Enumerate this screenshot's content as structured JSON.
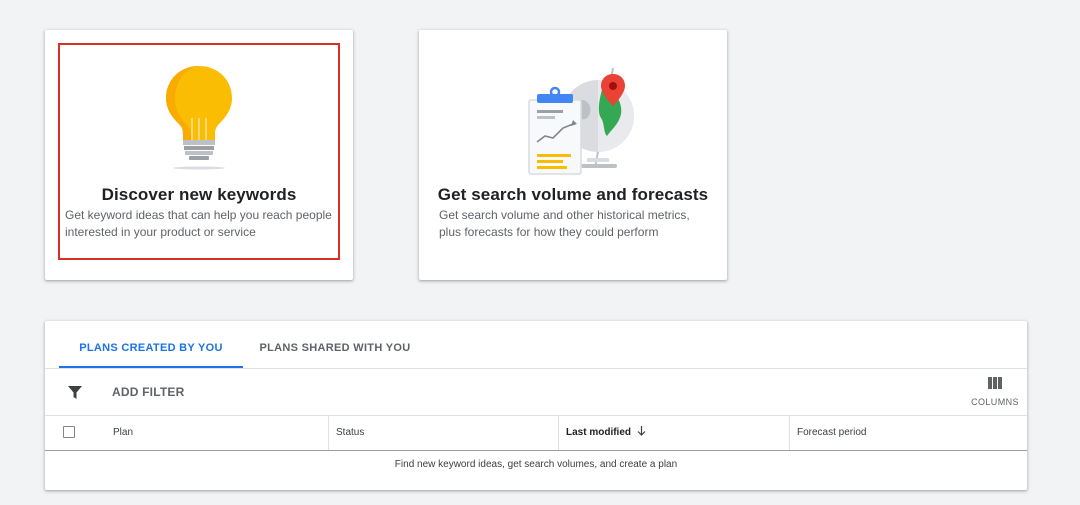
{
  "cards": [
    {
      "title": "Discover new keywords",
      "description": "Get keyword ideas that can help you reach people interested in your product or service",
      "icon": "lightbulb-illustration",
      "highlighted": true,
      "highlight_color": "#d93025"
    },
    {
      "title": "Get search volume and forecasts",
      "description": "Get search volume and other historical metrics, plus forecasts for how they could perform",
      "icon": "globe-clipboard-illustration"
    }
  ],
  "plans": {
    "tabs": [
      {
        "label": "PLANS CREATED BY YOU",
        "active": true
      },
      {
        "label": "PLANS SHARED WITH YOU",
        "active": false
      }
    ],
    "filter": {
      "label": "ADD FILTER",
      "icon": "filter-icon"
    },
    "columns": {
      "label": "COLUMNS",
      "icon": "columns-icon"
    },
    "table": {
      "headers": [
        "Plan",
        "Status",
        "Last modified",
        "Forecast period"
      ],
      "sorted_column": "Last modified",
      "sort_direction": "descending",
      "empty_message": "Find new keyword ideas, get search volumes, and create a plan"
    }
  },
  "colors": {
    "accent": "#1a73e8",
    "background": "#f1f3f4",
    "highlight": "#d93025"
  }
}
